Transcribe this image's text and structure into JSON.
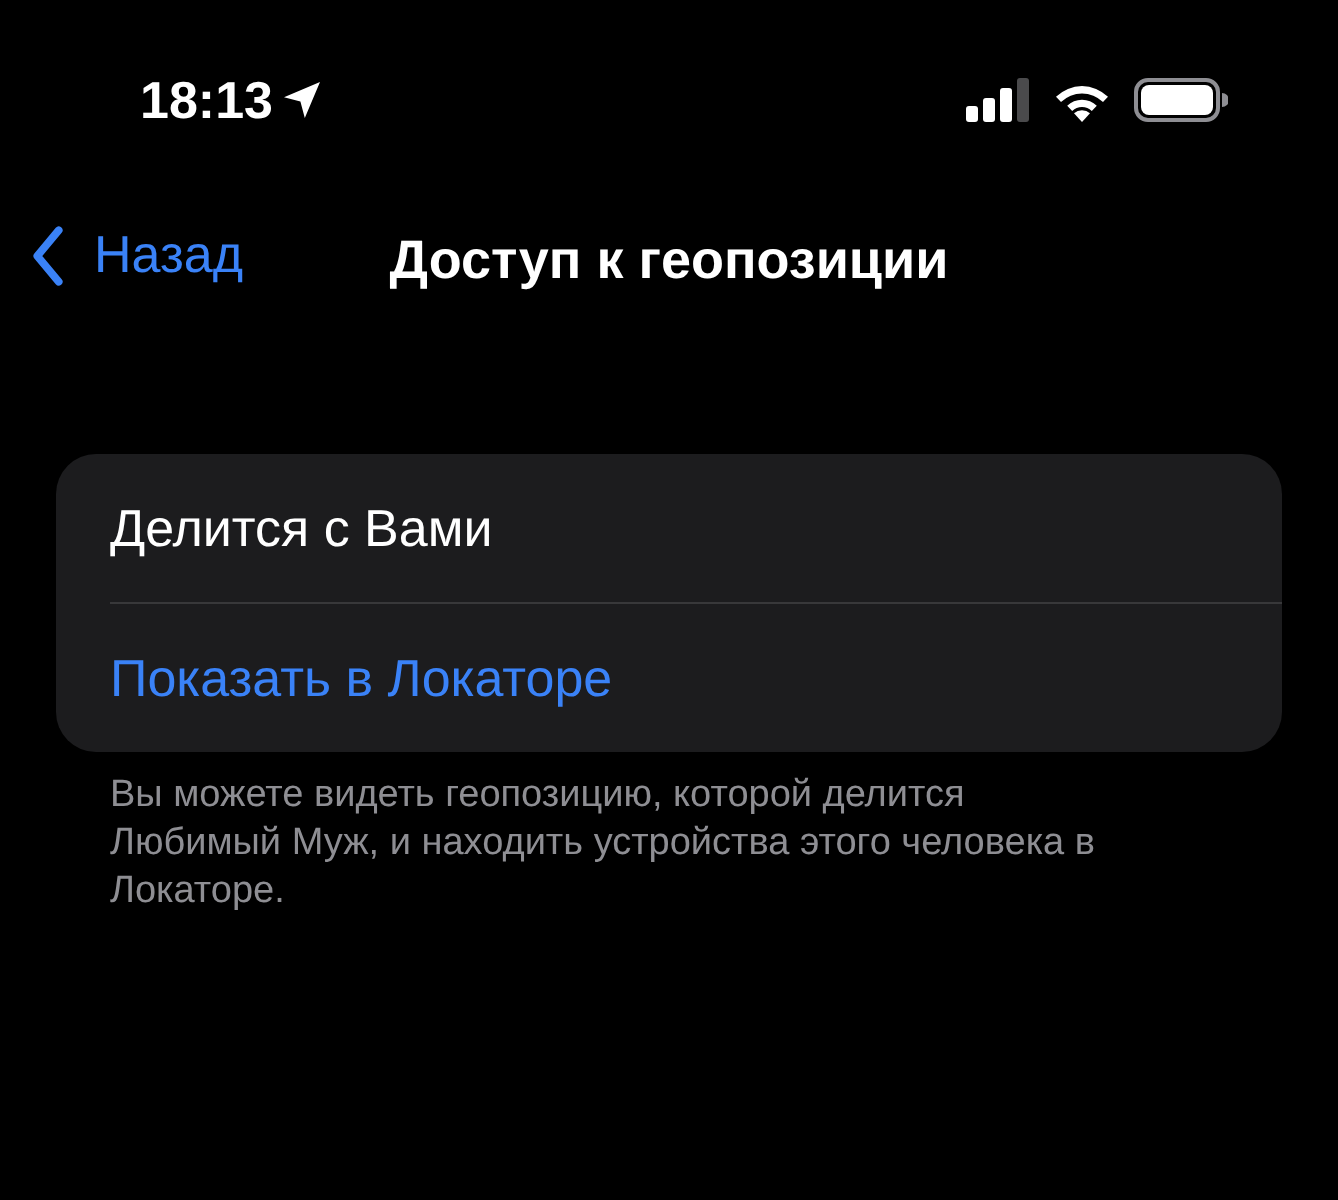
{
  "status_bar": {
    "time": "18:13"
  },
  "nav": {
    "back": "Назад",
    "title": "Доступ к геопозиции"
  },
  "card": {
    "rows": [
      {
        "kind": "label",
        "text": "Делится с Вами"
      },
      {
        "kind": "link",
        "text": "Показать в Локаторе"
      }
    ]
  },
  "footer": "Вы можете видеть геопозицию, которой делится Любимый Муж, и находить устройства этого человека в Локаторе."
}
